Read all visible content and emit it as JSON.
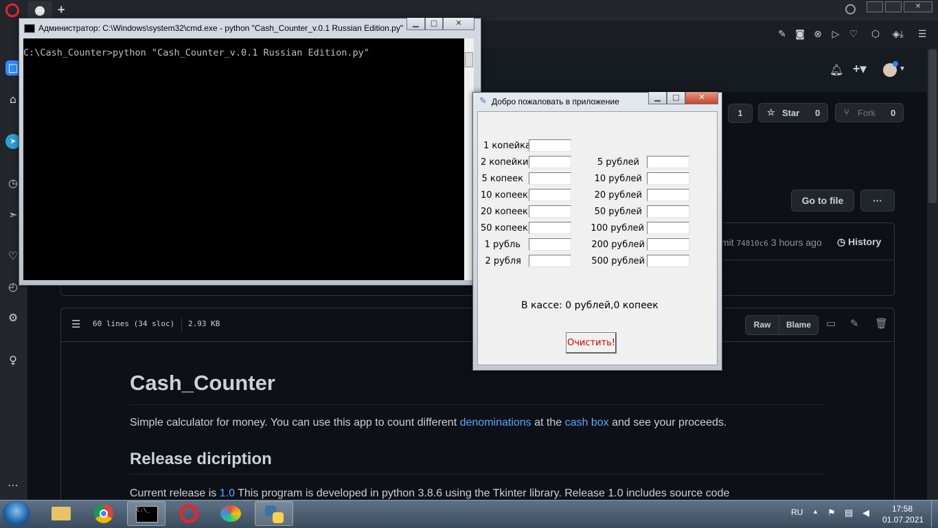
{
  "browser": {
    "tab_add": "+",
    "header": {
      "star_label": "Star",
      "fork_label": "Fork",
      "watch_count": "1",
      "star_count": "0",
      "fork_count": "0"
    }
  },
  "repo": {
    "go_to_file": "Go to file",
    "more": "···",
    "commit_prefix": "mit",
    "commit_hash": "74810c6",
    "commit_time": "3 hours ago",
    "history": "History",
    "file_stats": {
      "lines": "60 lines (34 sloc)",
      "size": "2.93 KB"
    },
    "raw": "Raw",
    "blame": "Blame"
  },
  "readme": {
    "title": "Cash_Counter",
    "p1_a": "Simple calculator for money. You can use this app to count different ",
    "p1_link1": "denominations",
    "p1_b": " at the ",
    "p1_link2": "cash box",
    "p1_c": " and see your proceeds.",
    "h2": "Release dicription",
    "p2_a": "Current release is ",
    "p2_link": "1.0",
    "p2_b": " This program is developed in python 3.8.6 using the Tkinter library. Release 1.0 includes source code"
  },
  "cmd_window": {
    "title": "Администратор: C:\\Windows\\system32\\cmd.exe - python  \"Cash_Counter_v.0.1 Russian Edition.py\"",
    "prompt": "C:\\Cash_Counter>python \"Cash_Counter_v.0.1 Russian Edition.py\""
  },
  "tk_window": {
    "title": "Добро пожаловать в приложение",
    "coins": [
      "1 копейка",
      "2 копейки",
      "5 копеек",
      "10 копеек",
      "20 копеек",
      "50 копеек",
      "1 рубль",
      "2 рубля"
    ],
    "bills": [
      "5 рублей",
      "10 рублей",
      "20 рублей",
      "50 рублей",
      "100 рублей",
      "200 рублей",
      "500 рублей"
    ],
    "total": "В кассе: 0 рублей,0 копеек",
    "clear_button": "Очистить!"
  },
  "taskbar": {
    "lang": "RU",
    "time": "17:58",
    "date": "01.07.2021"
  }
}
